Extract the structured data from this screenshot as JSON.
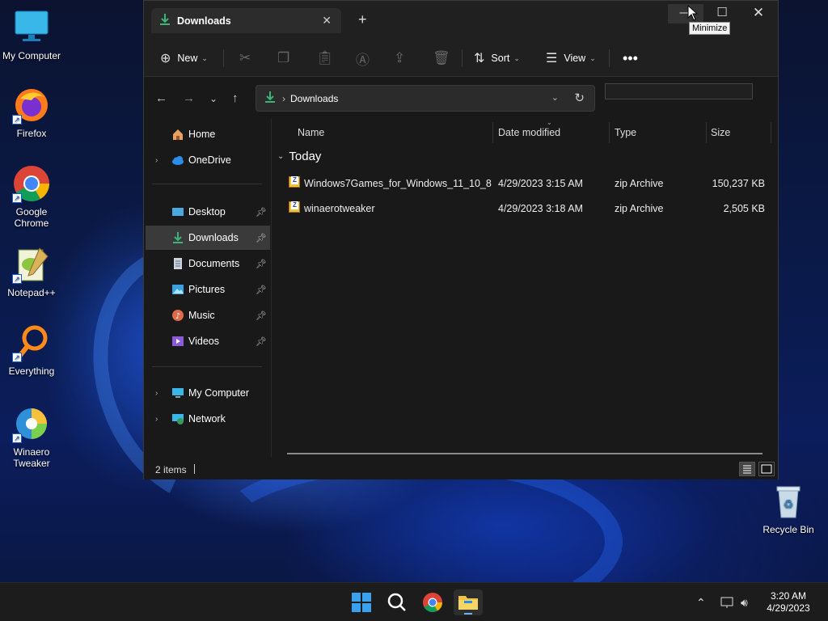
{
  "desktop": {
    "icons": [
      {
        "label": "My Computer"
      },
      {
        "label": "Firefox"
      },
      {
        "label": "Google Chrome"
      },
      {
        "label": "Notepad++"
      },
      {
        "label": "Everything"
      },
      {
        "label": "Winaero Tweaker"
      },
      {
        "label": "Recycle Bin"
      }
    ]
  },
  "window": {
    "tab_title": "Downloads",
    "tooltip": "Minimize",
    "toolbar": {
      "new_label": "New",
      "sort_label": "Sort",
      "view_label": "View"
    },
    "address": {
      "crumb": "Downloads",
      "search_placeholder": ""
    },
    "nav": {
      "items": [
        {
          "label": "Home"
        },
        {
          "label": "OneDrive"
        },
        {
          "label": "Desktop"
        },
        {
          "label": "Downloads"
        },
        {
          "label": "Documents"
        },
        {
          "label": "Pictures"
        },
        {
          "label": "Music"
        },
        {
          "label": "Videos"
        },
        {
          "label": "My Computer"
        },
        {
          "label": "Network"
        }
      ]
    },
    "columns": {
      "name": "Name",
      "date": "Date modified",
      "type": "Type",
      "size": "Size"
    },
    "group_label": "Today",
    "files": [
      {
        "name": "Windows7Games_for_Windows_11_10_8",
        "date": "4/29/2023 3:15 AM",
        "type": "zip Archive",
        "size": "150,237 KB"
      },
      {
        "name": "winaerotweaker",
        "date": "4/29/2023 3:18 AM",
        "type": "zip Archive",
        "size": "2,505 KB"
      }
    ],
    "status": {
      "count": "2 items"
    }
  },
  "taskbar": {
    "time": "3:20 AM",
    "date": "4/29/2023"
  },
  "colors": {
    "accent": "#0078d4",
    "downloads_green": "#3ab577",
    "window_bg": "#191919"
  }
}
